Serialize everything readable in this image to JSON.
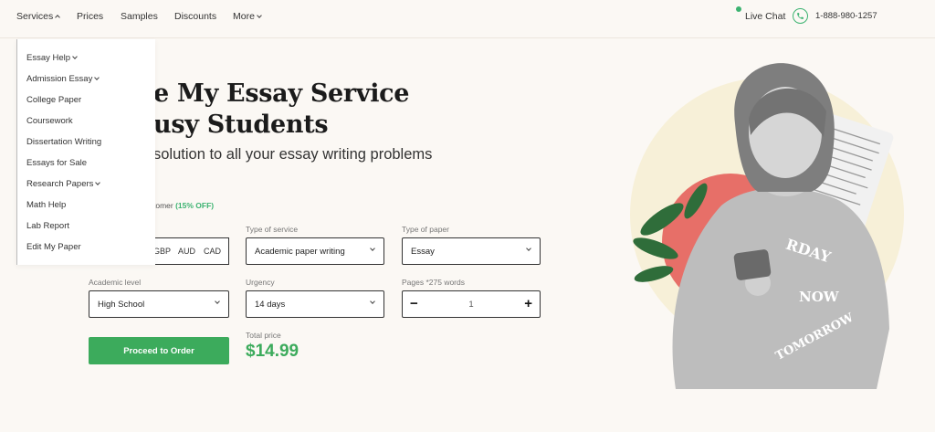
{
  "nav": {
    "items": [
      {
        "label": "Services",
        "caret": "up"
      },
      {
        "label": "Prices"
      },
      {
        "label": "Samples"
      },
      {
        "label": "Discounts"
      },
      {
        "label": "More",
        "caret": "down"
      }
    ],
    "live_chat": "Live Chat",
    "phone": "1-888-980-1257"
  },
  "dropdown": {
    "items": [
      {
        "label": "Essay Help",
        "caret": true
      },
      {
        "label": "Admission Essay",
        "caret": true
      },
      {
        "label": "College Paper"
      },
      {
        "label": "Coursework"
      },
      {
        "label": "Dissertation Writing"
      },
      {
        "label": "Essays for Sale"
      },
      {
        "label": "Research Papers",
        "caret": true
      },
      {
        "label": "Math Help"
      },
      {
        "label": "Lab Report"
      },
      {
        "label": "Edit My Paper"
      }
    ]
  },
  "hero": {
    "title_line1": "e My Essay Service",
    "title_line2": "usy Students",
    "subtitle": "solution to all your essay writing problems",
    "promo_text": "tomer ",
    "promo_off": "(15% OFF)"
  },
  "form": {
    "currencies": [
      "GBP",
      "AUD",
      "CAD"
    ],
    "type_of_service": {
      "label": "Type of service",
      "value": "Academic paper writing"
    },
    "type_of_paper": {
      "label": "Type of paper",
      "value": "Essay"
    },
    "academic_level": {
      "label": "Academic level",
      "value": "High School"
    },
    "urgency": {
      "label": "Urgency",
      "value": "14 days"
    },
    "pages": {
      "label": "Pages *275 words",
      "value": "1",
      "minus": "−",
      "plus": "+"
    },
    "order_button": "Proceed to Order",
    "total_label": "Total price",
    "total_price": "$14.99"
  },
  "colors": {
    "accent": "#3cab5c",
    "background": "#fbf8f4",
    "circle_red": "#e76f68",
    "circle_yellow": "#f7f0d8"
  },
  "illustration": {
    "shirt_text": [
      "RDAY",
      "NOW",
      "TOMORROW"
    ]
  }
}
